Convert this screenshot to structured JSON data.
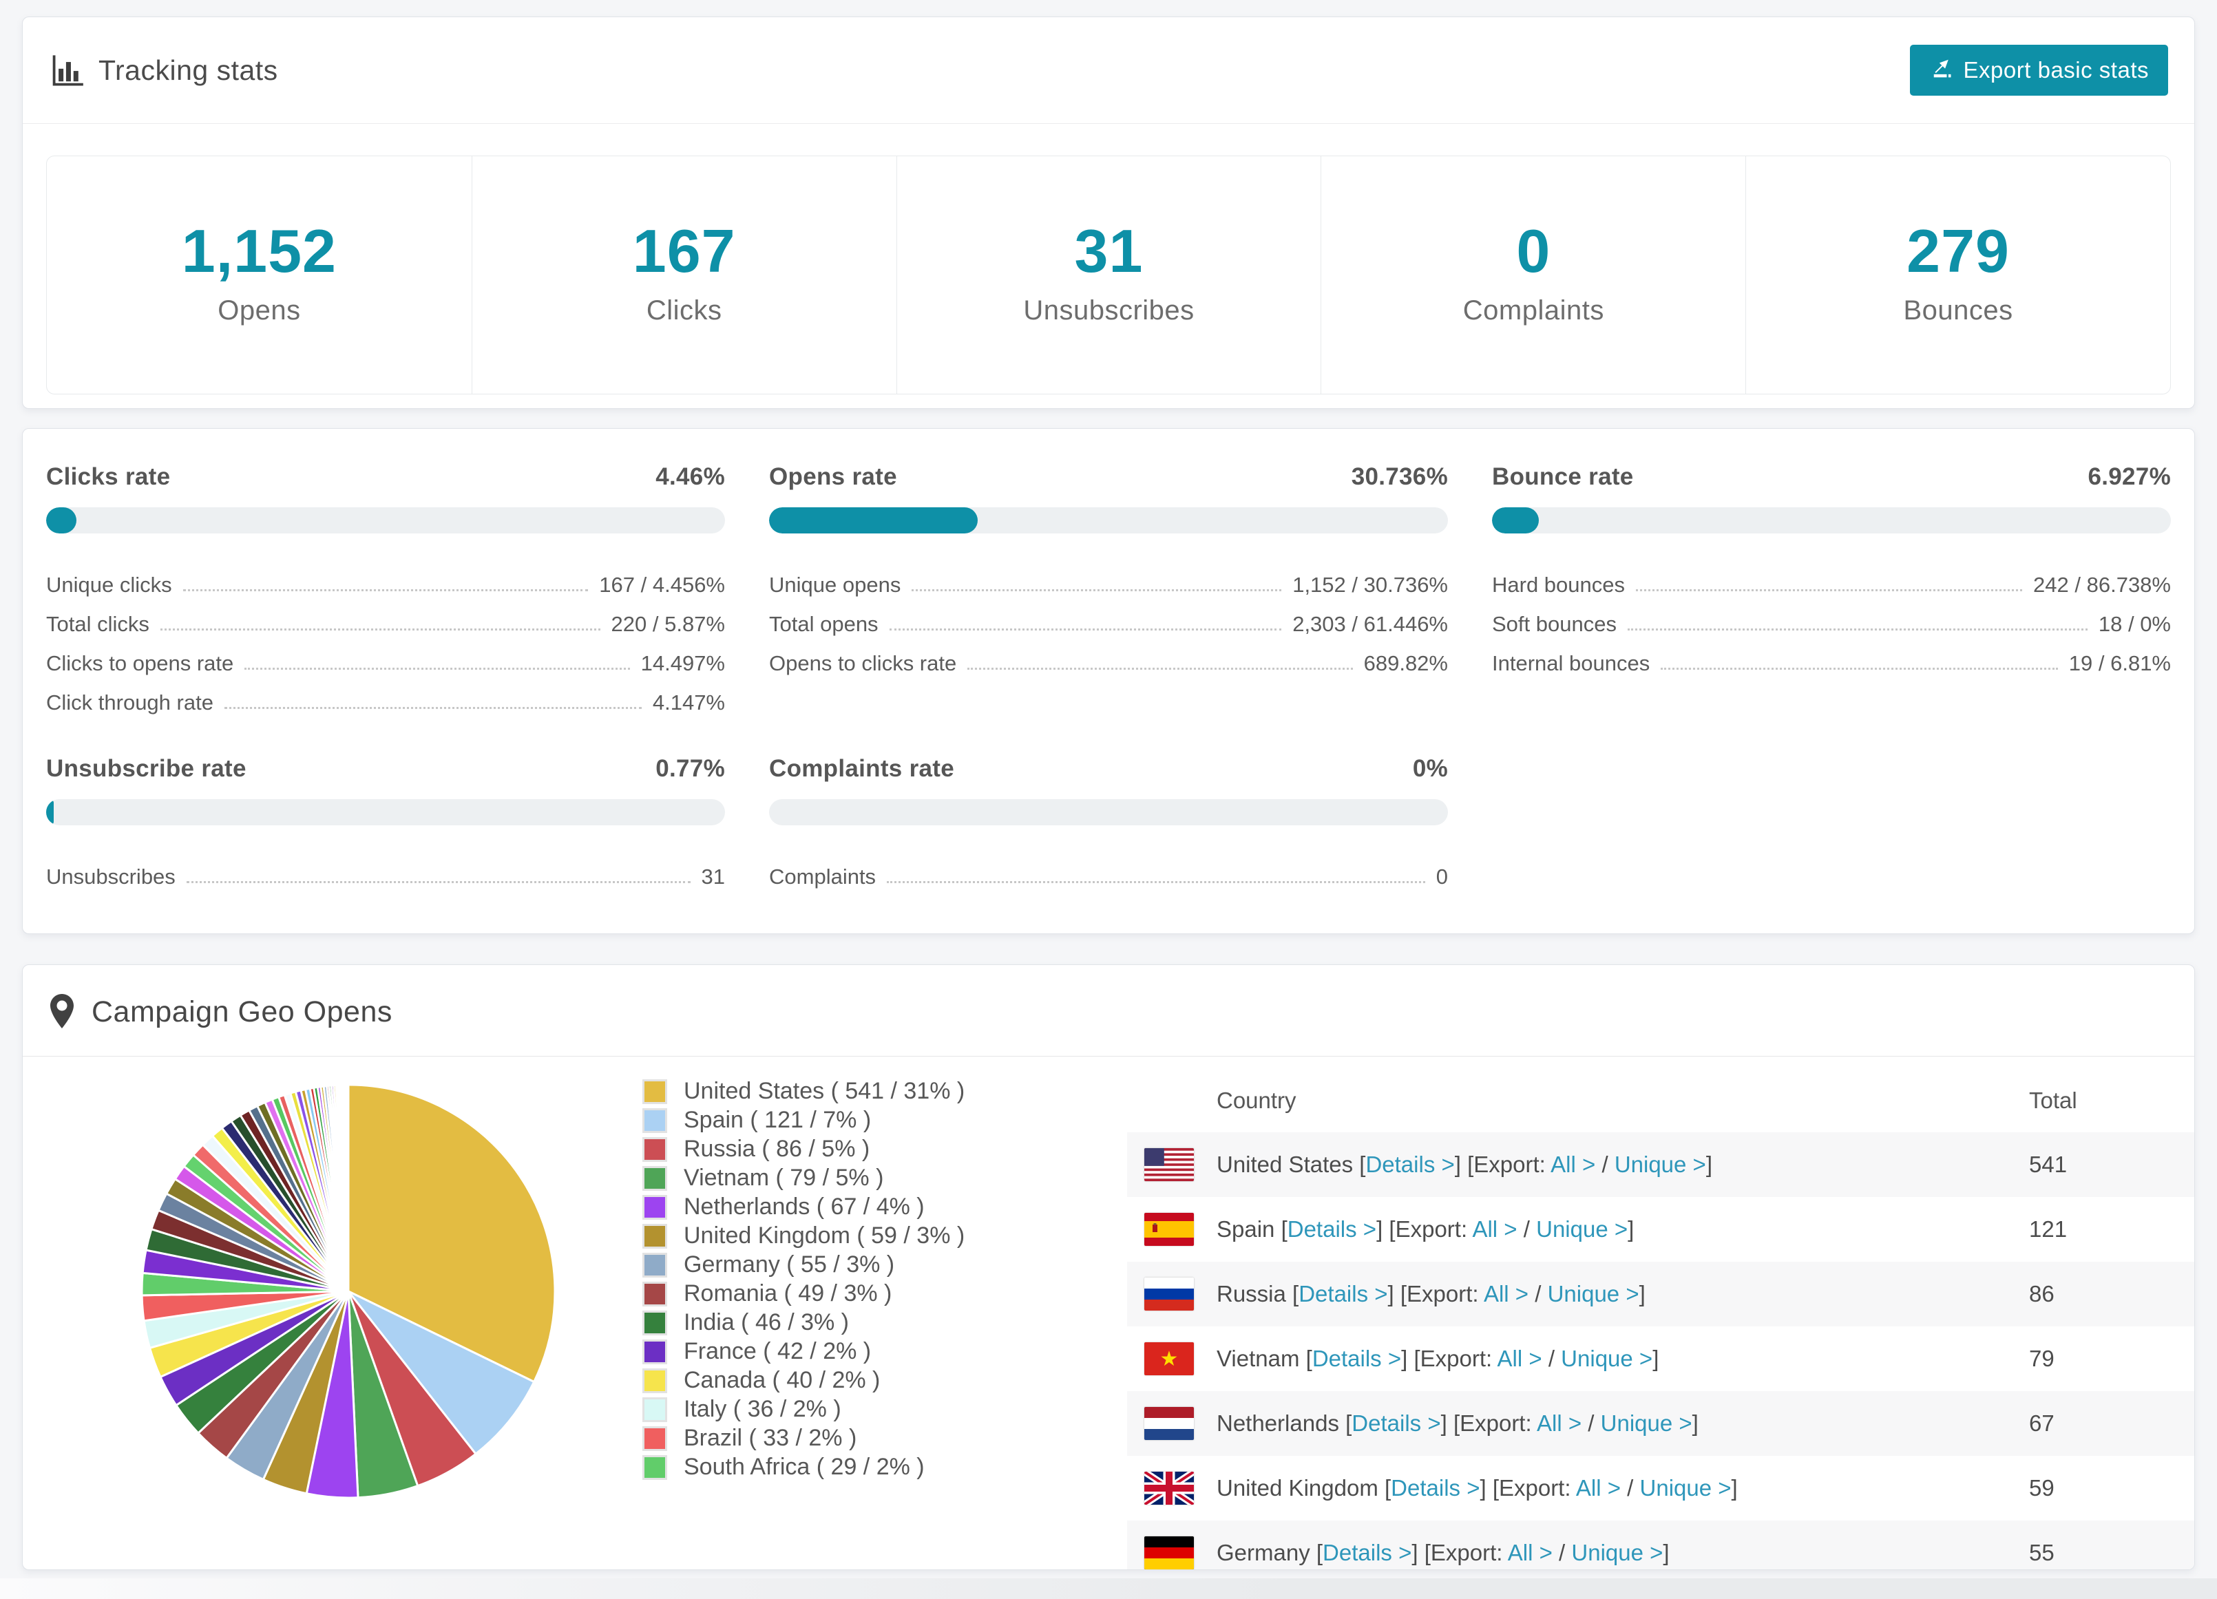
{
  "accent": "#0e90a7",
  "link_color": "#2e96ba",
  "header": {
    "title": "Tracking stats",
    "export_label": "Export basic stats"
  },
  "summary": [
    {
      "value": "1,152",
      "label": "Opens"
    },
    {
      "value": "167",
      "label": "Clicks"
    },
    {
      "value": "31",
      "label": "Unsubscribes"
    },
    {
      "value": "0",
      "label": "Complaints"
    },
    {
      "value": "279",
      "label": "Bounces"
    }
  ],
  "rates": {
    "blocks": [
      {
        "id": "clicks",
        "title": "Clicks rate",
        "value": "4.46%",
        "pct": 4.46,
        "rows": [
          [
            "Unique clicks",
            "167 / 4.456%"
          ],
          [
            "Total clicks",
            "220 / 5.87%"
          ],
          [
            "Clicks to opens rate",
            "14.497%"
          ],
          [
            "Click through rate",
            "4.147%"
          ]
        ]
      },
      {
        "id": "opens",
        "title": "Opens rate",
        "value": "30.736%",
        "pct": 30.736,
        "rows": [
          [
            "Unique opens",
            "1,152 / 30.736%"
          ],
          [
            "Total opens",
            "2,303 / 61.446%"
          ],
          [
            "Opens to clicks rate",
            "689.82%"
          ]
        ]
      },
      {
        "id": "bounce",
        "title": "Bounce rate",
        "value": "6.927%",
        "pct": 6.927,
        "rows": [
          [
            "Hard bounces",
            "242 / 86.738%"
          ],
          [
            "Soft bounces",
            "18 / 0%"
          ],
          [
            "Internal bounces",
            "19 / 6.81%"
          ]
        ]
      },
      {
        "id": "unsubscribe",
        "title": "Unsubscribe rate",
        "value": "0.77%",
        "pct": 0.77,
        "rows": [
          [
            "Unsubscribes",
            "31"
          ]
        ]
      },
      {
        "id": "complaints",
        "title": "Complaints rate",
        "value": "0%",
        "pct": 0,
        "rows": [
          [
            "Complaints",
            "0"
          ]
        ]
      }
    ]
  },
  "geo": {
    "title": "Campaign Geo Opens",
    "legend": [
      {
        "label": "United States ( 541 / 31% )",
        "color": "#e3bc42"
      },
      {
        "label": "Spain ( 121 / 7% )",
        "color": "#abd1f3"
      },
      {
        "label": "Russia ( 86 / 5% )",
        "color": "#cc4e54"
      },
      {
        "label": "Vietnam ( 79 / 5% )",
        "color": "#4fa557"
      },
      {
        "label": "Netherlands ( 67 / 4% )",
        "color": "#9d44f0"
      },
      {
        "label": "United Kingdom ( 59 / 3% )",
        "color": "#b3922f"
      },
      {
        "label": "Germany ( 55 / 3% )",
        "color": "#8fabc8"
      },
      {
        "label": "Romania ( 49 / 3% )",
        "color": "#a54747"
      },
      {
        "label": "India ( 46 / 3% )",
        "color": "#35813d"
      },
      {
        "label": "France ( 42 / 2% )",
        "color": "#6c2fc4"
      },
      {
        "label": "Canada ( 40 / 2% )",
        "color": "#f6e44c"
      },
      {
        "label": "Italy ( 36 / 2% )",
        "color": "#d8f8f5"
      },
      {
        "label": "Brazil ( 33 / 2% )",
        "color": "#f05f5f"
      },
      {
        "label": "South Africa ( 29 / 2% )",
        "color": "#61cd6a"
      }
    ],
    "labels": {
      "details": "Details >",
      "export": "Export:",
      "all": "All >",
      "unique": "Unique >",
      "open": "[",
      "close": "]",
      "slash": " / ",
      "space": " "
    },
    "table": {
      "headers": [
        "Country",
        "Total"
      ],
      "rows": [
        {
          "flag": "us",
          "country": "United States",
          "total": "541"
        },
        {
          "flag": "es",
          "country": "Spain",
          "total": "121"
        },
        {
          "flag": "ru",
          "country": "Russia",
          "total": "86"
        },
        {
          "flag": "vn",
          "country": "Vietnam",
          "total": "79"
        },
        {
          "flag": "nl",
          "country": "Netherlands",
          "total": "67"
        },
        {
          "flag": "gb",
          "country": "United Kingdom",
          "total": "59"
        },
        {
          "flag": "de",
          "country": "Germany",
          "total": "55"
        }
      ]
    }
  },
  "chart_data": {
    "type": "pie",
    "title": "Campaign Geo Opens",
    "legend_position": "right",
    "start_angle_deg": 0,
    "series": [
      {
        "name": "United States",
        "value": 541,
        "share": "31%",
        "color": "#e3bc42"
      },
      {
        "name": "Spain",
        "value": 121,
        "share": "7%",
        "color": "#abd1f3"
      },
      {
        "name": "Russia",
        "value": 86,
        "share": "5%",
        "color": "#cc4e54"
      },
      {
        "name": "Vietnam",
        "value": 79,
        "share": "5%",
        "color": "#4fa557"
      },
      {
        "name": "Netherlands",
        "value": 67,
        "share": "4%",
        "color": "#9d44f0"
      },
      {
        "name": "United Kingdom",
        "value": 59,
        "share": "3%",
        "color": "#b3922f"
      },
      {
        "name": "Germany",
        "value": 55,
        "share": "3%",
        "color": "#8fabc8"
      },
      {
        "name": "Romania",
        "value": 49,
        "share": "3%",
        "color": "#a54747"
      },
      {
        "name": "India",
        "value": 46,
        "share": "3%",
        "color": "#35813d"
      },
      {
        "name": "France",
        "value": 42,
        "share": "2%",
        "color": "#6c2fc4"
      },
      {
        "name": "Canada",
        "value": 40,
        "share": "2%",
        "color": "#f6e44c"
      },
      {
        "name": "Italy",
        "value": 36,
        "share": "2%",
        "color": "#d8f8f5"
      },
      {
        "name": "Brazil",
        "value": 33,
        "share": "2%",
        "color": "#f05f5f"
      },
      {
        "name": "South Africa",
        "value": 29,
        "share": "2%",
        "color": "#61cd6a"
      }
    ],
    "other_slices_note": "many small unlabeled country slices tapering to hairlines",
    "other_slices": [
      {
        "v": 30,
        "c": "#7b2fd0"
      },
      {
        "v": 28,
        "c": "#2f6b35"
      },
      {
        "v": 26,
        "c": "#7c2f2f"
      },
      {
        "v": 24,
        "c": "#6b82a0"
      },
      {
        "v": 22,
        "c": "#8a7c2a"
      },
      {
        "v": 20,
        "c": "#d558ea"
      },
      {
        "v": 19,
        "c": "#64d26e"
      },
      {
        "v": 18,
        "c": "#f06a6a"
      },
      {
        "v": 17,
        "c": "#eef8fd"
      },
      {
        "v": 16,
        "c": "#f3ee4a"
      },
      {
        "v": 15,
        "c": "#2b2b70"
      },
      {
        "v": 14,
        "c": "#274f2c"
      },
      {
        "v": 13,
        "c": "#6e2424"
      },
      {
        "v": 12,
        "c": "#55708c"
      },
      {
        "v": 11,
        "c": "#6e6e24"
      },
      {
        "v": 10,
        "c": "#e070f0"
      },
      {
        "v": 9,
        "c": "#58c862"
      },
      {
        "v": 8,
        "c": "#e86060"
      },
      {
        "v": 8,
        "c": "#f3fbff"
      },
      {
        "v": 7,
        "c": "#e8df3e"
      },
      {
        "v": 7,
        "c": "#8a52e8"
      },
      {
        "v": 6,
        "c": "#c8a030"
      },
      {
        "v": 6,
        "c": "#88c8f0"
      },
      {
        "v": 5,
        "c": "#d03a3a"
      },
      {
        "v": 5,
        "c": "#30a040"
      },
      {
        "v": 4,
        "c": "#a040e0"
      },
      {
        "v": 4,
        "c": "#d0b040"
      },
      {
        "v": 4,
        "c": "#90b0d0"
      },
      {
        "v": 3,
        "c": "#b05050"
      },
      {
        "v": 3,
        "c": "#208030"
      },
      {
        "v": 3,
        "c": "#8030c0"
      },
      {
        "v": 3,
        "c": "#e0c040"
      },
      {
        "v": 2,
        "c": "#70c8e8"
      },
      {
        "v": 2,
        "c": "#c04040"
      },
      {
        "v": 2,
        "c": "#40b050"
      },
      {
        "v": 2,
        "c": "#b050e0"
      },
      {
        "v": 2,
        "c": "#c0a830"
      },
      {
        "v": 1,
        "c": "#a0c0e0"
      },
      {
        "v": 1,
        "c": "#d06060"
      },
      {
        "v": 1,
        "c": "#50b060"
      },
      {
        "v": 1,
        "c": "#9060d0"
      },
      {
        "v": 1,
        "c": "#d0c050"
      },
      {
        "v": 1,
        "c": "#80b0e0"
      }
    ]
  }
}
